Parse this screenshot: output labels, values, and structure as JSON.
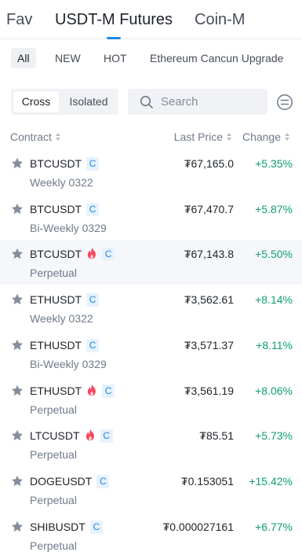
{
  "top_tabs": [
    {
      "label": "Fav",
      "active": false
    },
    {
      "label": "USDT-M Futures",
      "active": true
    },
    {
      "label": "Coin-M",
      "active": false
    }
  ],
  "categories": [
    {
      "label": "All",
      "active": true
    },
    {
      "label": "NEW",
      "active": false
    },
    {
      "label": "HOT",
      "active": false
    },
    {
      "label": "Ethereum Cancun Upgrade",
      "active": false
    }
  ],
  "margin_mode": {
    "options": [
      {
        "label": "Cross",
        "active": true
      },
      {
        "label": "Isolated",
        "active": false
      }
    ]
  },
  "search": {
    "placeholder": "Search",
    "value": ""
  },
  "headers": {
    "contract": "Contract",
    "last_price": "Last Price",
    "change": "Change"
  },
  "colors": {
    "accent": "#1e88e5",
    "up": "#0e9f6e",
    "star": "#848e9c",
    "fire": "#f6465d"
  },
  "rows": [
    {
      "symbol": "BTCUSDT",
      "hot": false,
      "tag": "C",
      "sub": "Weekly 0322",
      "price": "₮67,165.0",
      "change": "+5.35%"
    },
    {
      "symbol": "BTCUSDT",
      "hot": false,
      "tag": "C",
      "sub": "Bi-Weekly 0329",
      "price": "₮67,470.7",
      "change": "+5.87%"
    },
    {
      "symbol": "BTCUSDT",
      "hot": true,
      "tag": "C",
      "sub": "Perpetual",
      "price": "₮67,143.8",
      "change": "+5.50%"
    },
    {
      "symbol": "ETHUSDT",
      "hot": false,
      "tag": "C",
      "sub": "Weekly 0322",
      "price": "₮3,562.61",
      "change": "+8.14%"
    },
    {
      "symbol": "ETHUSDT",
      "hot": false,
      "tag": "C",
      "sub": "Bi-Weekly 0329",
      "price": "₮3,571.37",
      "change": "+8.11%"
    },
    {
      "symbol": "ETHUSDT",
      "hot": true,
      "tag": "C",
      "sub": "Perpetual",
      "price": "₮3,561.19",
      "change": "+8.06%"
    },
    {
      "symbol": "LTCUSDT",
      "hot": true,
      "tag": "C",
      "sub": "Perpetual",
      "price": "₮85.51",
      "change": "+5.73%"
    },
    {
      "symbol": "DOGEUSDT",
      "hot": false,
      "tag": "C",
      "sub": "Perpetual",
      "price": "₮0.153051",
      "change": "+15.42%"
    },
    {
      "symbol": "SHIBUSDT",
      "hot": false,
      "tag": "C",
      "sub": "Perpetual",
      "price": "₮0.000027161",
      "change": "+6.77%"
    }
  ]
}
